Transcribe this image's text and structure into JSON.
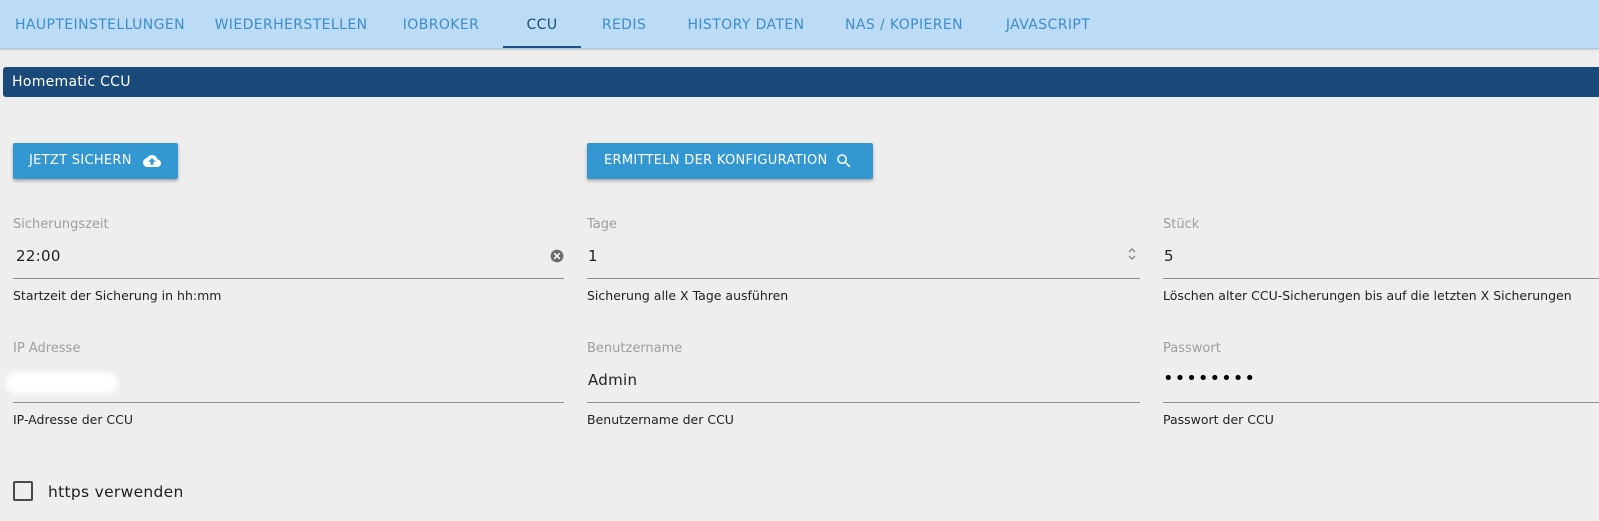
{
  "tabs": [
    {
      "label": "HAUPTEINSTELLUNGEN",
      "active": false
    },
    {
      "label": "WIEDERHERSTELLEN",
      "active": false
    },
    {
      "label": "IOBROKER",
      "active": false
    },
    {
      "label": "CCU",
      "active": true
    },
    {
      "label": "REDIS",
      "active": false
    },
    {
      "label": "HISTORY DATEN",
      "active": false
    },
    {
      "label": "NAS / KOPIEREN",
      "active": false
    },
    {
      "label": "JAVASCRIPT",
      "active": false
    }
  ],
  "section": {
    "title": "Homematic CCU"
  },
  "buttons": {
    "backup_now": {
      "label": "JETZT SICHERN",
      "icon": "cloud-upload-icon"
    },
    "detect_config": {
      "label": "ERMITTELN DER KONFIGURATION",
      "icon": "search-icon"
    }
  },
  "fields": {
    "backup_time": {
      "label": "Sicherungszeit",
      "value": "22:00",
      "help": "Startzeit der Sicherung in hh:mm"
    },
    "days": {
      "label": "Tage",
      "value": "1",
      "help": "Sicherung alle X Tage ausführen"
    },
    "count": {
      "label": "Stück",
      "value": "5",
      "help": "Löschen alter CCU-Sicherungen bis auf die letzten X Sicherungen"
    },
    "ip_address": {
      "label": "IP Adresse",
      "value": "",
      "help": "IP-Adresse der CCU"
    },
    "username": {
      "label": "Benutzername",
      "value": "Admin",
      "help": "Benutzername der CCU"
    },
    "password": {
      "label": "Passwort",
      "value": "••••••••",
      "help": "Passwort der CCU"
    }
  },
  "https": {
    "label": "https verwenden",
    "checked": false
  },
  "colors": {
    "tabbar_bg": "#bcdcf6",
    "tab_text": "#3c8dc9",
    "tab_active": "#1b4a74",
    "header_bg": "#1a4a7a",
    "button_bg": "#3398d1",
    "page_bg": "#eeeeee"
  }
}
